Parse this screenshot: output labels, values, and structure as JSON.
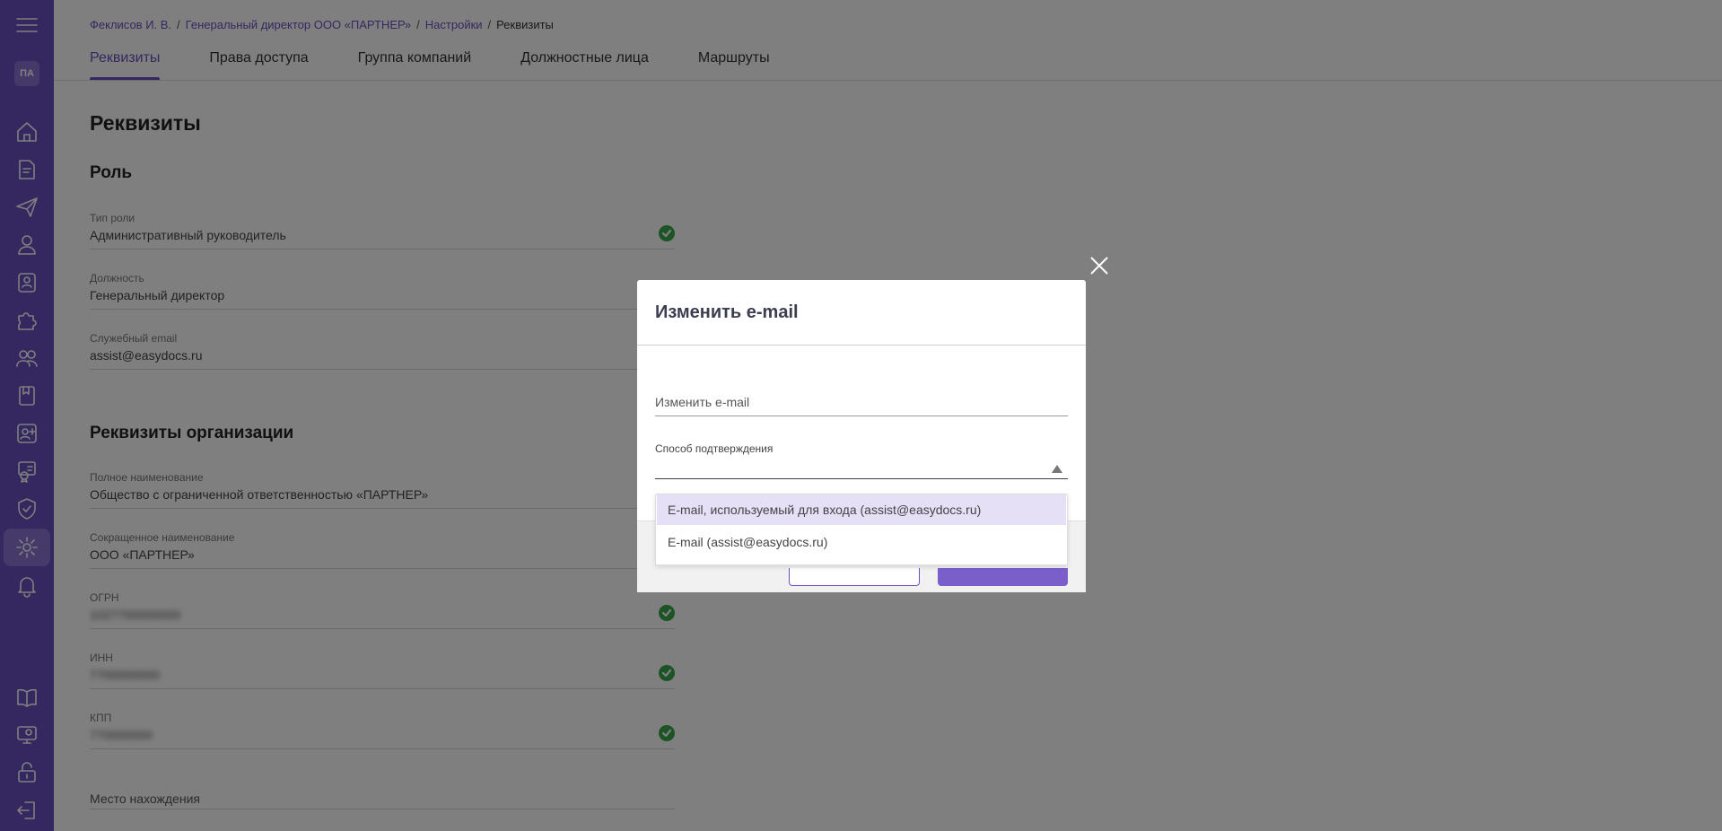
{
  "sidebar": {
    "avatar": "ПА",
    "icons": [
      "menu-icon",
      "home-icon",
      "documents-icon",
      "send-icon",
      "user-icon",
      "badge-icon",
      "puzzle-icon",
      "users-icon",
      "book-icon",
      "add-user-icon",
      "certificate-icon",
      "shield-icon",
      "gear-icon",
      "bell-icon",
      "manual-icon",
      "support-icon",
      "lock-icon",
      "logout-icon"
    ],
    "accent": "#6b4fc0"
  },
  "breadcrumb": {
    "items": [
      "Феклисов И. В.",
      "Генеральный директор ООО «ПАРТНЕР»",
      "Настройки"
    ],
    "current": "Реквизиты",
    "separator": "/"
  },
  "tabs": [
    {
      "label": "Реквизиты",
      "active": true
    },
    {
      "label": "Права доступа",
      "active": false
    },
    {
      "label": "Группа компаний",
      "active": false
    },
    {
      "label": "Должностные лица",
      "active": false
    },
    {
      "label": "Маршруты",
      "active": false
    }
  ],
  "page": {
    "title": "Реквизиты",
    "role_section": "Роль",
    "org_section": "Реквизиты организации",
    "fields": {
      "role_type": {
        "label": "Тип роли",
        "value": "Административный руководитель"
      },
      "position": {
        "label": "Должность",
        "value": "Генеральный директор"
      },
      "service_email": {
        "label": "Служебный email",
        "value": "assist@easydocs.ru"
      },
      "full_name": {
        "label": "Полное наименование",
        "value": "Общество с ограниченной ответственностью «ПАРТНЕР»"
      },
      "short_name": {
        "label": "Сокращенное наименование",
        "value": "ООО «ПАРТНЕР»"
      },
      "ogrn": {
        "label": "ОГРН",
        "value": "1027700000000"
      },
      "inn": {
        "label": "ИНН",
        "value": "7700000000"
      },
      "kpp": {
        "label": "КПП",
        "value": "770000000"
      },
      "location": {
        "placeholder": "Место нахождения"
      }
    }
  },
  "modal": {
    "title": "Изменить e-mail",
    "email_placeholder": "Изменить e-mail",
    "confirm_label": "Способ подтверждения",
    "options": [
      "E-mail, используемый для входа (assist@easydocs.ru)",
      "E-mail (assist@easydocs.ru)"
    ]
  }
}
